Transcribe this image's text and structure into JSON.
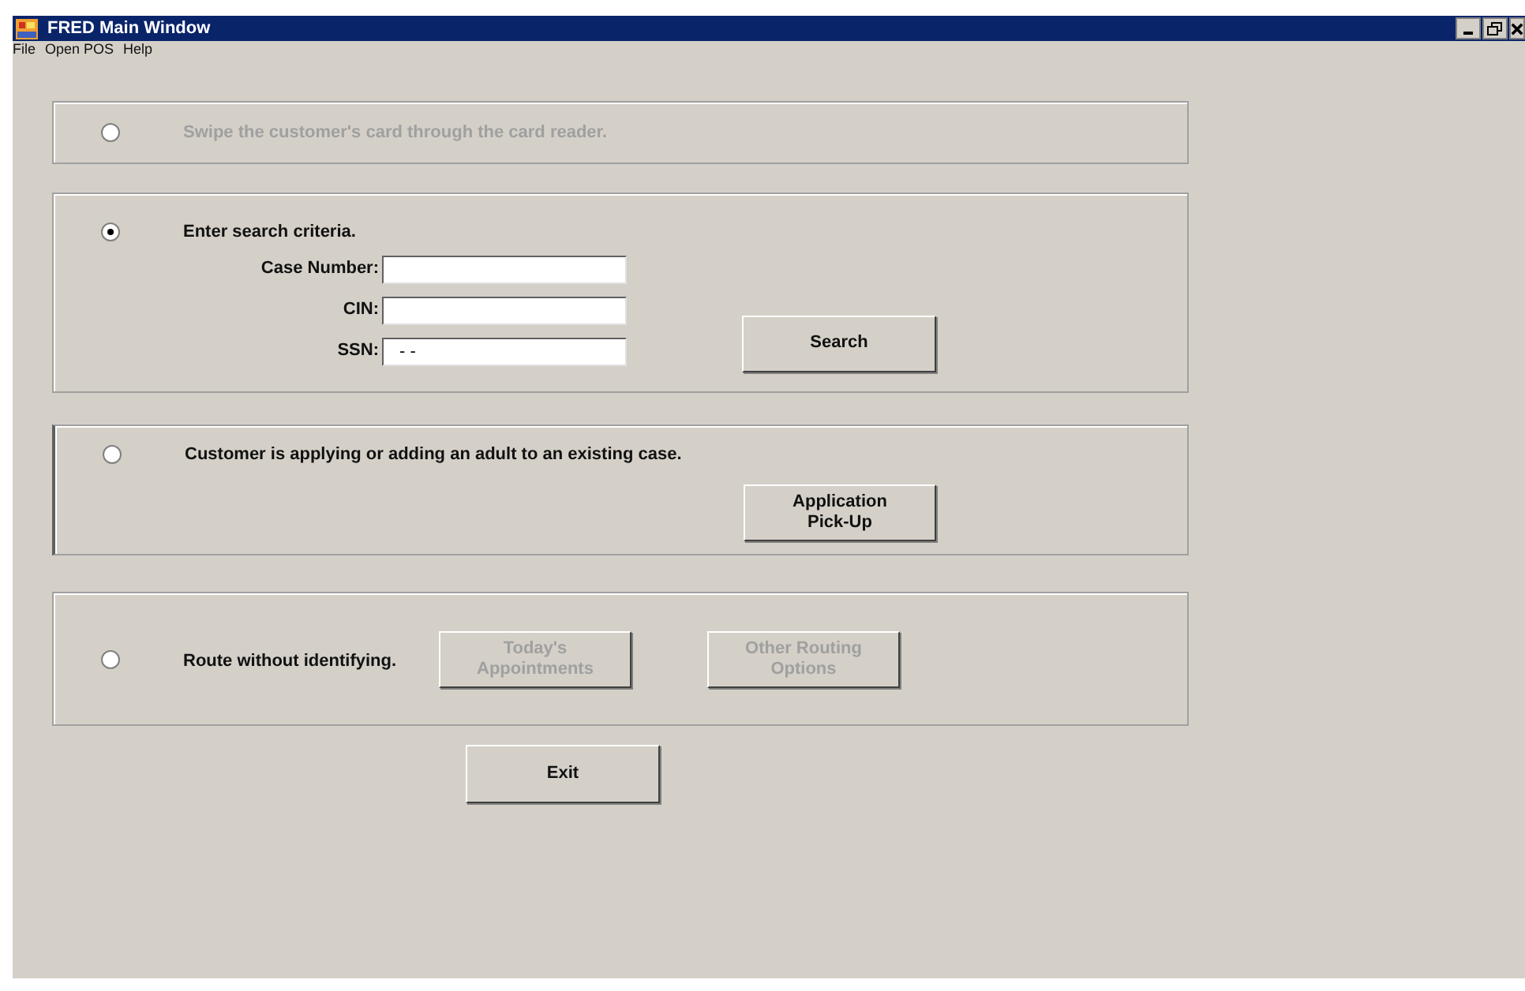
{
  "window": {
    "title": "FRED Main Window"
  },
  "menu": [
    "File",
    "Open POS",
    "Help"
  ],
  "sections": [
    {
      "kind": "card",
      "label": "Swipe the customer's card through the card reader.",
      "selected": false,
      "disabled": true
    },
    {
      "kind": "search",
      "label": "Enter search criteria.",
      "selected": true,
      "disabled": false,
      "fields": [
        {
          "label": "Case Number:"
        },
        {
          "label": "CIN:"
        },
        {
          "label": "SSN:",
          "value": "- -"
        }
      ],
      "buttons": [
        {
          "label": "Search",
          "disabled": false
        }
      ]
    },
    {
      "kind": "application",
      "label": "Customer is applying or adding an adult to an existing case.",
      "selected": false,
      "disabled": false,
      "buttons": [
        {
          "label": "Application\nPick-Up",
          "disabled": false
        }
      ]
    },
    {
      "kind": "route",
      "label": "Route without identifying.",
      "selected": false,
      "disabled": false,
      "buttons": [
        {
          "label": "Today's\nAppointments",
          "disabled": true
        },
        {
          "label": "Other Routing\nOptions",
          "disabled": true
        }
      ]
    }
  ],
  "exit_button": {
    "label": "Exit"
  }
}
